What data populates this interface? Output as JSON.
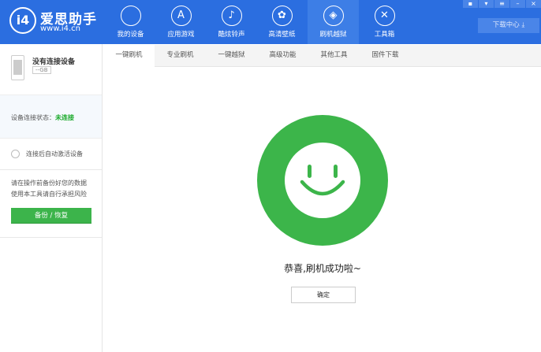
{
  "header": {
    "logo_text": "i4",
    "brand": "爱思助手",
    "url": "www.i4.cn",
    "nav": [
      {
        "label": "我的设备",
        "icon": "apple-icon"
      },
      {
        "label": "应用游戏",
        "icon": "app-store-icon"
      },
      {
        "label": "酷炫铃声",
        "icon": "bell-icon"
      },
      {
        "label": "高清壁纸",
        "icon": "flower-icon"
      },
      {
        "label": "刷机越狱",
        "icon": "dropbox-icon",
        "active": true
      },
      {
        "label": "工具箱",
        "icon": "tools-icon"
      }
    ],
    "download_center": "下载中心",
    "window_controls": [
      "message-icon",
      "skin-icon",
      "menu-icon",
      "minimize-icon",
      "close-icon"
    ]
  },
  "sidebar": {
    "device_name": "没有连接设备",
    "storage": "--GB",
    "status_label": "设备连接状态：",
    "status_value": "未连接",
    "auto_activate": "连接后自动激活设备",
    "warning_line1": "请在操作前备份好您的数据",
    "warning_line2": "使用本工具请自行承担风险",
    "backup_button": "备份 / 恢复"
  },
  "tabs": [
    "一键刷机",
    "专业刷机",
    "一键越狱",
    "高级功能",
    "其他工具",
    "固件下载"
  ],
  "main": {
    "message": "恭喜,刷机成功啦~",
    "ok_button": "确定"
  },
  "colors": {
    "header": "#2b6ee0",
    "success": "#3cb54a"
  }
}
